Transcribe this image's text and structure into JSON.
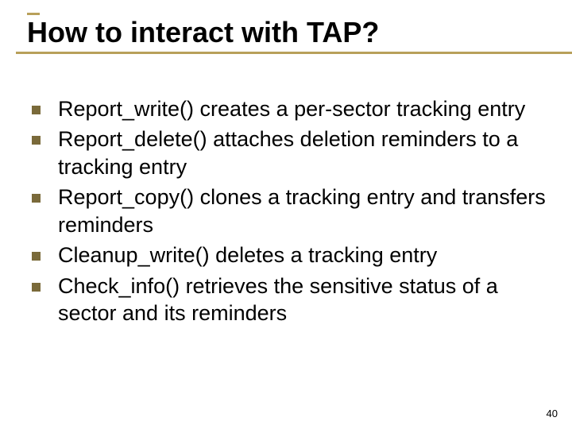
{
  "slide": {
    "title": "How to interact with TAP?",
    "bullets": [
      "Report_write() creates a per-sector tracking entry",
      "Report_delete() attaches deletion reminders to a tracking entry",
      "Report_copy() clones a tracking entry and transfers reminders",
      "Cleanup_write() deletes a tracking entry",
      "Check_info() retrieves the sensitive status of a sector and its reminders"
    ],
    "page_number": "40"
  }
}
